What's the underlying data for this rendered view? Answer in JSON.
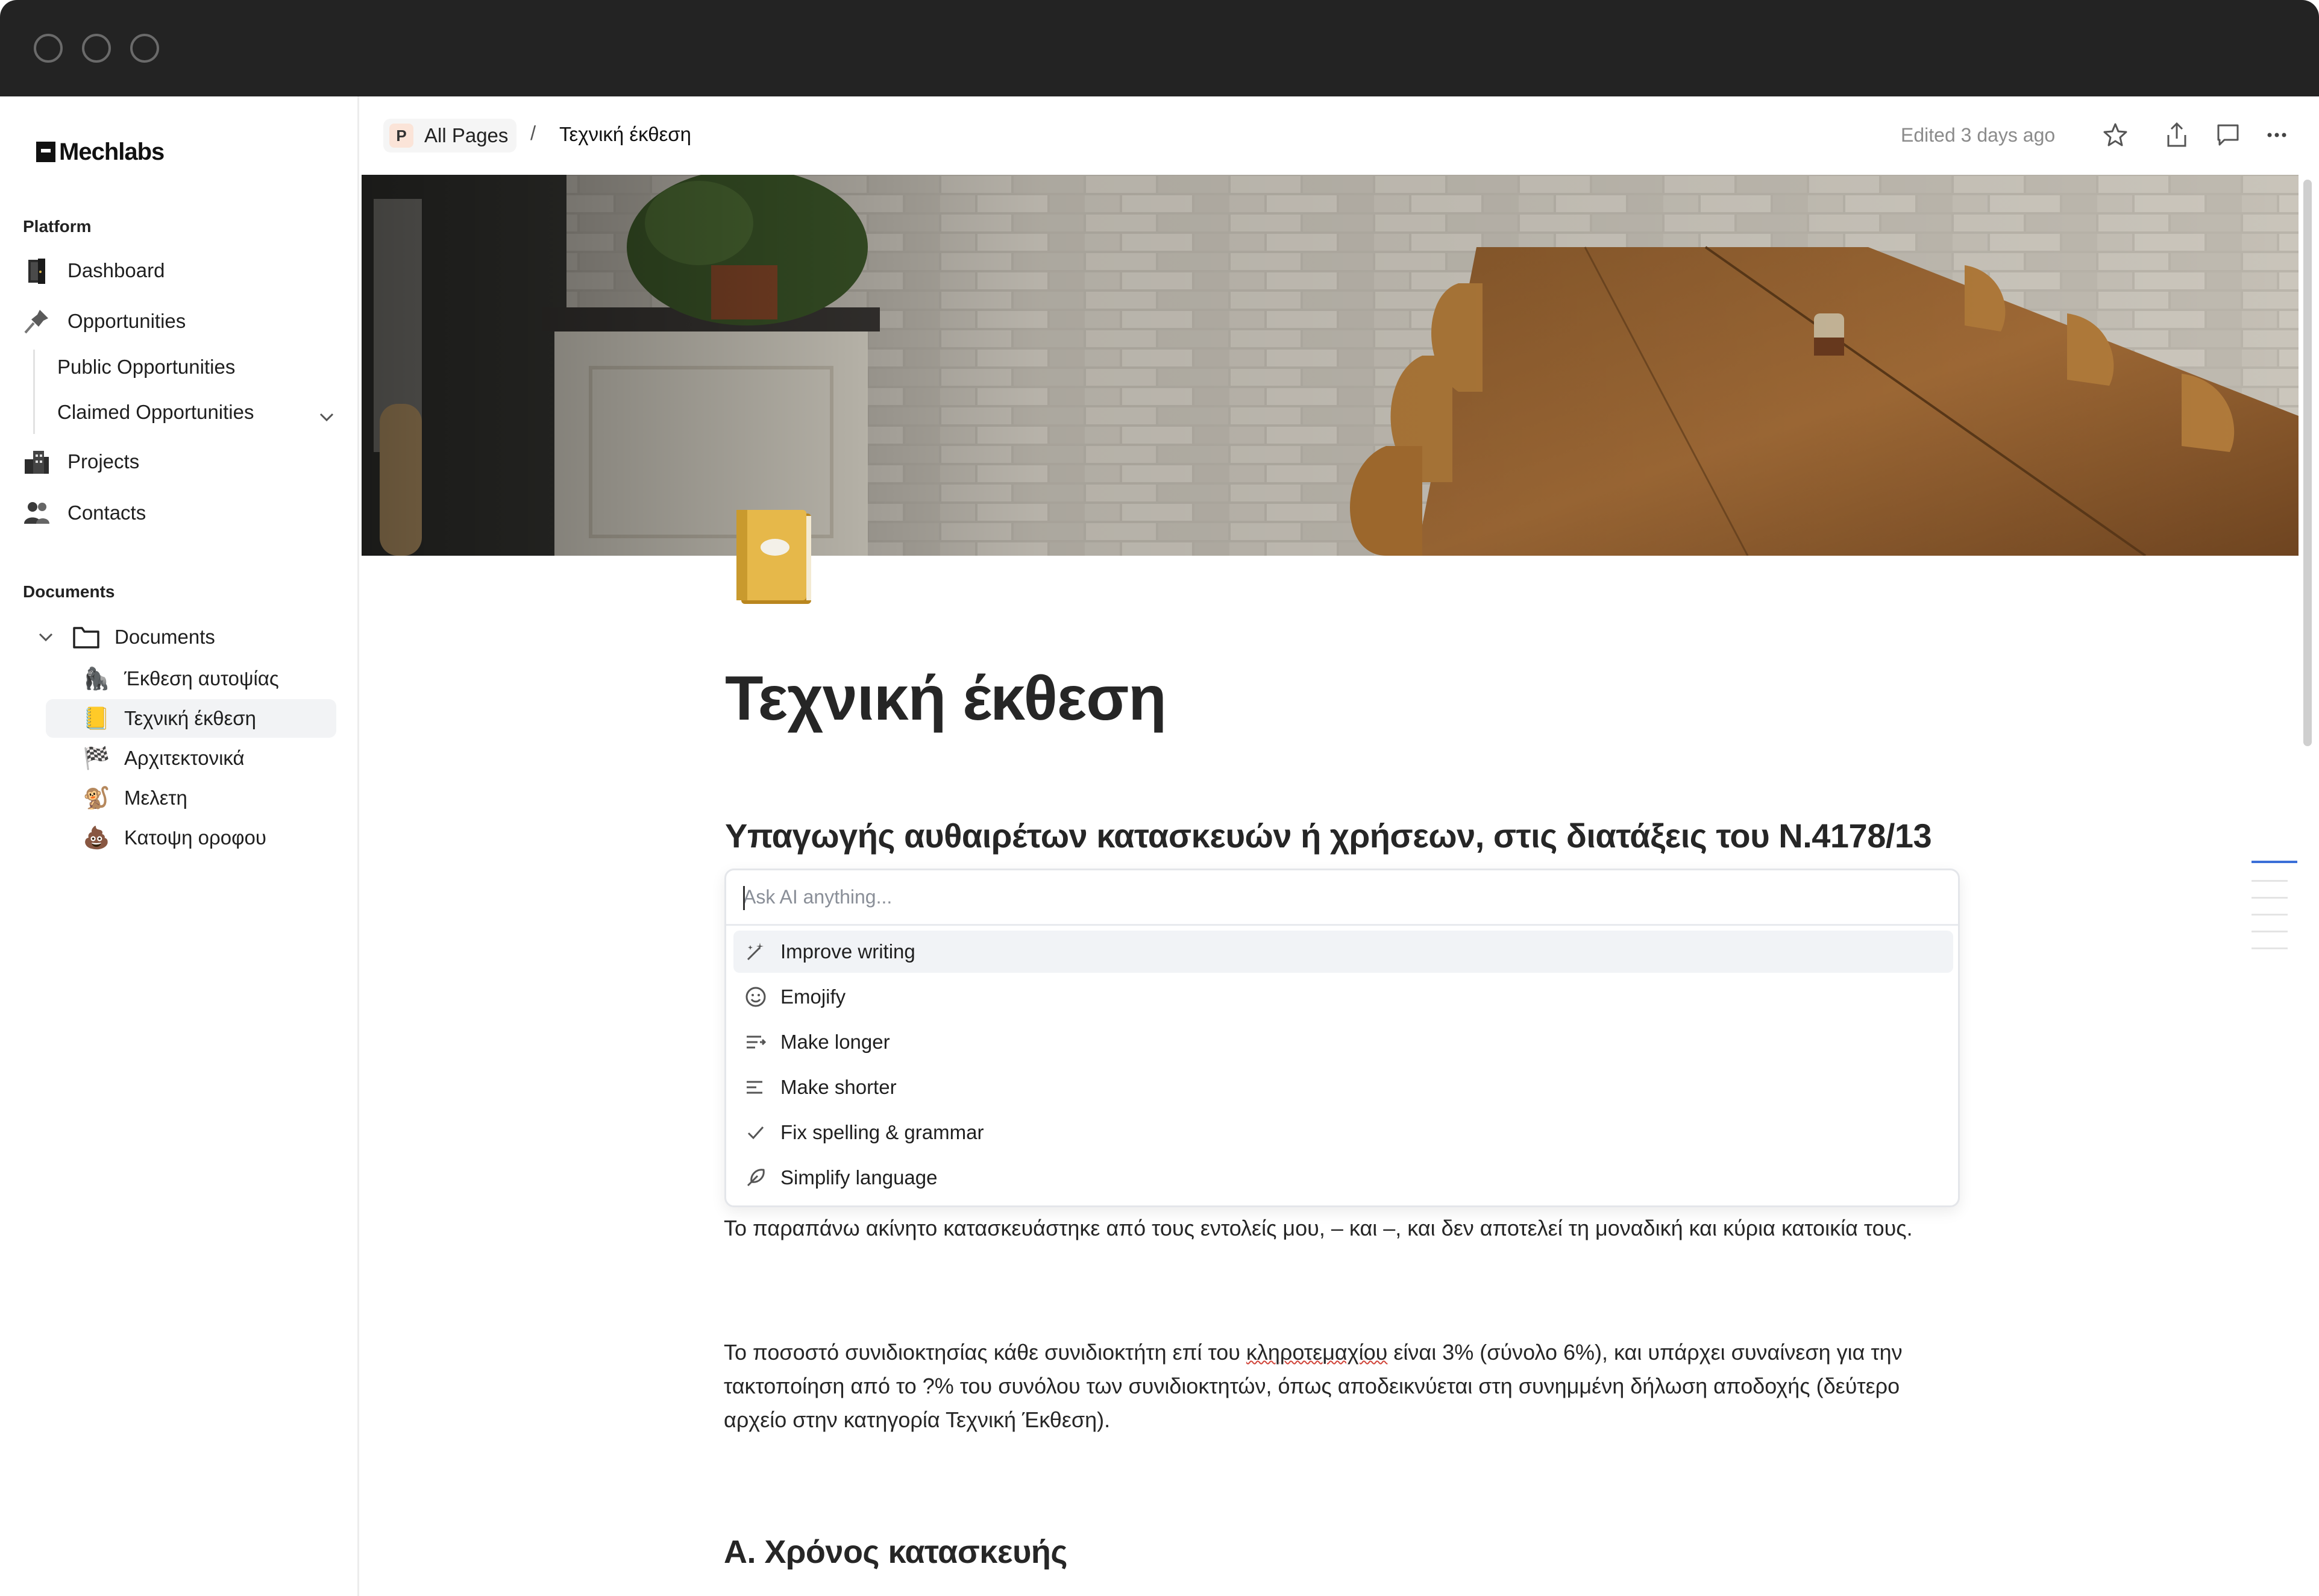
{
  "window": {
    "controls": [
      "close",
      "minimize",
      "zoom"
    ]
  },
  "sidebar": {
    "brand": "Mechlabs",
    "platform_label": "Platform",
    "items": [
      {
        "label": "Dashboard",
        "icon": "building-door-icon"
      },
      {
        "label": "Opportunities",
        "icon": "pushpin-icon"
      },
      {
        "label": "Projects",
        "icon": "city-icon"
      },
      {
        "label": "Contacts",
        "icon": "people-icon"
      }
    ],
    "opportunities_sub": [
      "Public Opportunities",
      "Claimed Opportunities"
    ],
    "documents_label": "Documents",
    "documents_folder": "Documents",
    "documents": [
      {
        "label": "Έκθεση αυτοψίας",
        "icon": "gorilla-icon",
        "emoji": "🦍"
      },
      {
        "label": "Τεχνική έκθεση",
        "icon": "notebook-icon",
        "emoji": "📒"
      },
      {
        "label": "Αρχιτεκτονικά",
        "icon": "checkered-flag-icon",
        "emoji": "🏁"
      },
      {
        "label": "Μελετη",
        "icon": "monkey-icon",
        "emoji": "🐒"
      },
      {
        "label": "Κατοψη οροφου",
        "icon": "poop-icon",
        "emoji": "💩"
      }
    ]
  },
  "topbar": {
    "root_badge": "P",
    "root_label": "All Pages",
    "separator": "/",
    "current": "Τεχνική έκθεση",
    "edited": "Edited 3 days ago",
    "icons": [
      "star-icon",
      "share-icon",
      "comment-icon",
      "more-icon"
    ]
  },
  "page": {
    "title": "Τεχνική έκθεση",
    "subtitle": "Υπαγωγής αυθαιρέτων κατασκευών ή χρήσεων, στις διατάξεις του Ν.4178/13",
    "paragraph1": "Το παραπάνω ακίνητο κατασκευάστηκε από τους εντολείς μου, – και –, και δεν αποτελεί τη μοναδική και κύρια κατοικία τους.",
    "paragraph2_before": "Το ποσοστό συνιδιοκτησίας κάθε συνιδιοκτήτη επί του ",
    "paragraph2_misspelled": "κληροτεμαχίου",
    "paragraph2_after": " είναι 3% (σύνολο 6%), και υπάρχει συναίνεση για την τακτοποίηση από το ?% του συνόλου των συνιδιοκτητών, όπως αποδεικνύεται στη συνημμένη δήλωση αποδοχής (δεύτερο αρχείο στην κατηγορία Τεχνική Έκθεση).",
    "heading_a": "Α. Χρόνος κατασκευής"
  },
  "ai_menu": {
    "placeholder": "Ask AI anything...",
    "items": [
      {
        "label": "Improve writing",
        "icon": "magic-wand-icon"
      },
      {
        "label": "Emojify",
        "icon": "smiley-icon"
      },
      {
        "label": "Make longer",
        "icon": "lines-extend-icon"
      },
      {
        "label": "Make shorter",
        "icon": "lines-shorten-icon"
      },
      {
        "label": "Fix spelling & grammar",
        "icon": "check-icon"
      },
      {
        "label": "Simplify language",
        "icon": "feather-icon"
      }
    ]
  },
  "colors": {
    "accent": "#3b6fd8",
    "titlebar": "#232323",
    "hover": "#f1f3f6"
  }
}
